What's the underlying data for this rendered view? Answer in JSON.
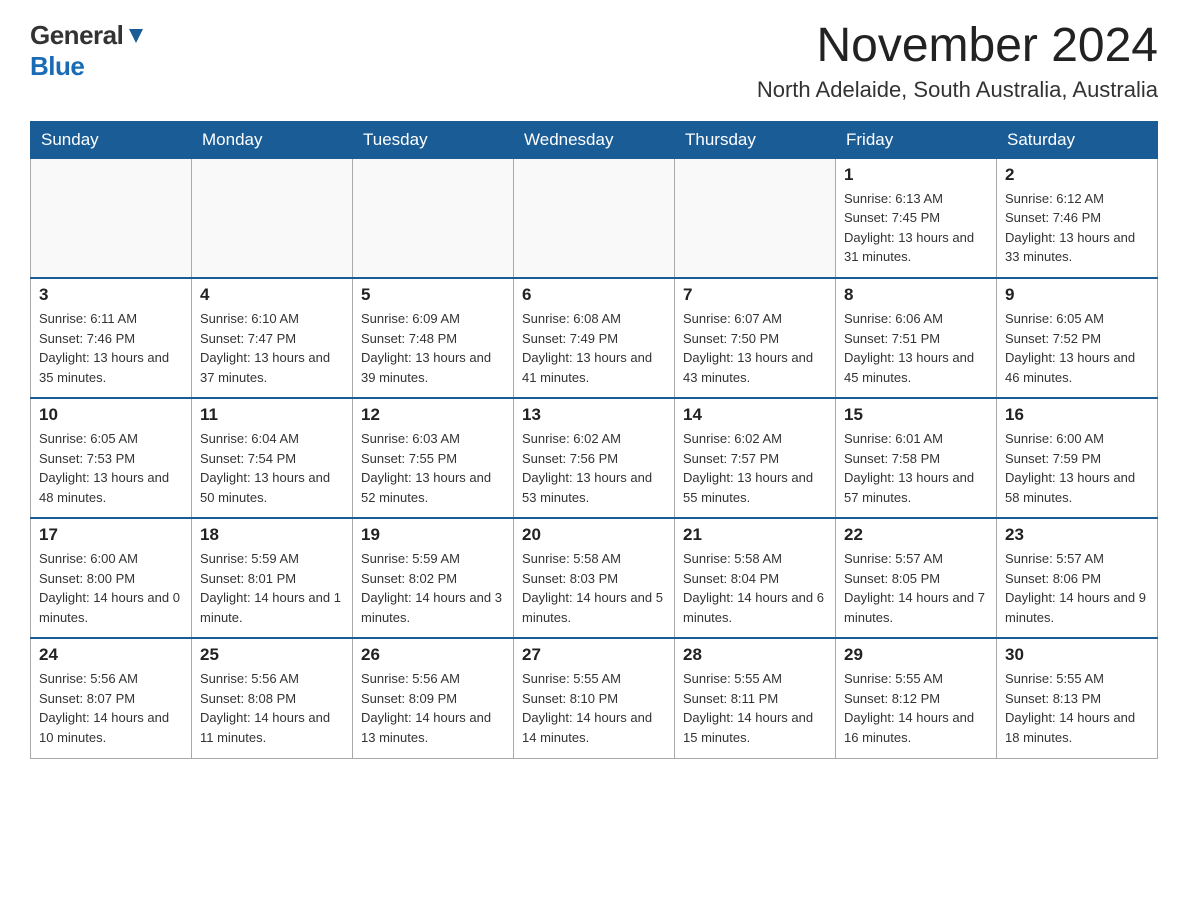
{
  "header": {
    "logo_general": "General",
    "logo_blue": "Blue",
    "month_title": "November 2024",
    "location": "North Adelaide, South Australia, Australia"
  },
  "calendar": {
    "days_of_week": [
      "Sunday",
      "Monday",
      "Tuesday",
      "Wednesday",
      "Thursday",
      "Friday",
      "Saturday"
    ],
    "weeks": [
      [
        {
          "day": "",
          "info": ""
        },
        {
          "day": "",
          "info": ""
        },
        {
          "day": "",
          "info": ""
        },
        {
          "day": "",
          "info": ""
        },
        {
          "day": "",
          "info": ""
        },
        {
          "day": "1",
          "info": "Sunrise: 6:13 AM\nSunset: 7:45 PM\nDaylight: 13 hours and 31 minutes."
        },
        {
          "day": "2",
          "info": "Sunrise: 6:12 AM\nSunset: 7:46 PM\nDaylight: 13 hours and 33 minutes."
        }
      ],
      [
        {
          "day": "3",
          "info": "Sunrise: 6:11 AM\nSunset: 7:46 PM\nDaylight: 13 hours and 35 minutes."
        },
        {
          "day": "4",
          "info": "Sunrise: 6:10 AM\nSunset: 7:47 PM\nDaylight: 13 hours and 37 minutes."
        },
        {
          "day": "5",
          "info": "Sunrise: 6:09 AM\nSunset: 7:48 PM\nDaylight: 13 hours and 39 minutes."
        },
        {
          "day": "6",
          "info": "Sunrise: 6:08 AM\nSunset: 7:49 PM\nDaylight: 13 hours and 41 minutes."
        },
        {
          "day": "7",
          "info": "Sunrise: 6:07 AM\nSunset: 7:50 PM\nDaylight: 13 hours and 43 minutes."
        },
        {
          "day": "8",
          "info": "Sunrise: 6:06 AM\nSunset: 7:51 PM\nDaylight: 13 hours and 45 minutes."
        },
        {
          "day": "9",
          "info": "Sunrise: 6:05 AM\nSunset: 7:52 PM\nDaylight: 13 hours and 46 minutes."
        }
      ],
      [
        {
          "day": "10",
          "info": "Sunrise: 6:05 AM\nSunset: 7:53 PM\nDaylight: 13 hours and 48 minutes."
        },
        {
          "day": "11",
          "info": "Sunrise: 6:04 AM\nSunset: 7:54 PM\nDaylight: 13 hours and 50 minutes."
        },
        {
          "day": "12",
          "info": "Sunrise: 6:03 AM\nSunset: 7:55 PM\nDaylight: 13 hours and 52 minutes."
        },
        {
          "day": "13",
          "info": "Sunrise: 6:02 AM\nSunset: 7:56 PM\nDaylight: 13 hours and 53 minutes."
        },
        {
          "day": "14",
          "info": "Sunrise: 6:02 AM\nSunset: 7:57 PM\nDaylight: 13 hours and 55 minutes."
        },
        {
          "day": "15",
          "info": "Sunrise: 6:01 AM\nSunset: 7:58 PM\nDaylight: 13 hours and 57 minutes."
        },
        {
          "day": "16",
          "info": "Sunrise: 6:00 AM\nSunset: 7:59 PM\nDaylight: 13 hours and 58 minutes."
        }
      ],
      [
        {
          "day": "17",
          "info": "Sunrise: 6:00 AM\nSunset: 8:00 PM\nDaylight: 14 hours and 0 minutes."
        },
        {
          "day": "18",
          "info": "Sunrise: 5:59 AM\nSunset: 8:01 PM\nDaylight: 14 hours and 1 minute."
        },
        {
          "day": "19",
          "info": "Sunrise: 5:59 AM\nSunset: 8:02 PM\nDaylight: 14 hours and 3 minutes."
        },
        {
          "day": "20",
          "info": "Sunrise: 5:58 AM\nSunset: 8:03 PM\nDaylight: 14 hours and 5 minutes."
        },
        {
          "day": "21",
          "info": "Sunrise: 5:58 AM\nSunset: 8:04 PM\nDaylight: 14 hours and 6 minutes."
        },
        {
          "day": "22",
          "info": "Sunrise: 5:57 AM\nSunset: 8:05 PM\nDaylight: 14 hours and 7 minutes."
        },
        {
          "day": "23",
          "info": "Sunrise: 5:57 AM\nSunset: 8:06 PM\nDaylight: 14 hours and 9 minutes."
        }
      ],
      [
        {
          "day": "24",
          "info": "Sunrise: 5:56 AM\nSunset: 8:07 PM\nDaylight: 14 hours and 10 minutes."
        },
        {
          "day": "25",
          "info": "Sunrise: 5:56 AM\nSunset: 8:08 PM\nDaylight: 14 hours and 11 minutes."
        },
        {
          "day": "26",
          "info": "Sunrise: 5:56 AM\nSunset: 8:09 PM\nDaylight: 14 hours and 13 minutes."
        },
        {
          "day": "27",
          "info": "Sunrise: 5:55 AM\nSunset: 8:10 PM\nDaylight: 14 hours and 14 minutes."
        },
        {
          "day": "28",
          "info": "Sunrise: 5:55 AM\nSunset: 8:11 PM\nDaylight: 14 hours and 15 minutes."
        },
        {
          "day": "29",
          "info": "Sunrise: 5:55 AM\nSunset: 8:12 PM\nDaylight: 14 hours and 16 minutes."
        },
        {
          "day": "30",
          "info": "Sunrise: 5:55 AM\nSunset: 8:13 PM\nDaylight: 14 hours and 18 minutes."
        }
      ]
    ]
  }
}
